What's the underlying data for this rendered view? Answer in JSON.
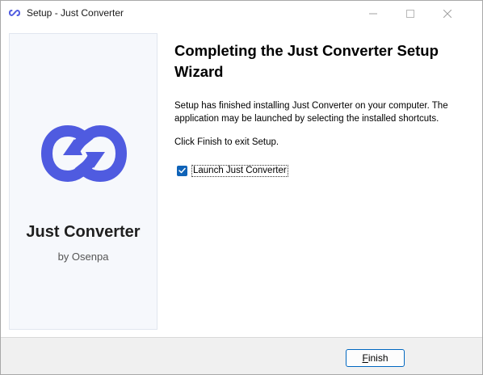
{
  "window": {
    "title": "Setup - Just Converter",
    "app_icon": "infinity-arrows-icon",
    "controls": [
      "minimize-icon",
      "maximize-icon",
      "close-icon"
    ]
  },
  "sidebar": {
    "logo_icon": "infinity-arrows-logo",
    "product_name": "Just Converter",
    "product_by": "by Osenpa"
  },
  "main": {
    "heading": "Completing the Just Converter Setup Wizard",
    "description": "Setup has finished installing Just Converter on your computer. The application may be launched by selecting the installed shortcuts.",
    "finish_note": "Click Finish to exit Setup.",
    "launch_checkbox": {
      "label": "Launch Just Converter",
      "checked": true
    }
  },
  "footer": {
    "finish_accel": "F",
    "finish_rest": "inish"
  },
  "colors": {
    "brand": "#4f5be0",
    "checkbox_accent": "#0f63b8",
    "button_border": "#0067c0",
    "sidebar_bg": "#f6f8fc",
    "footer_bg": "#f0f0f0"
  }
}
